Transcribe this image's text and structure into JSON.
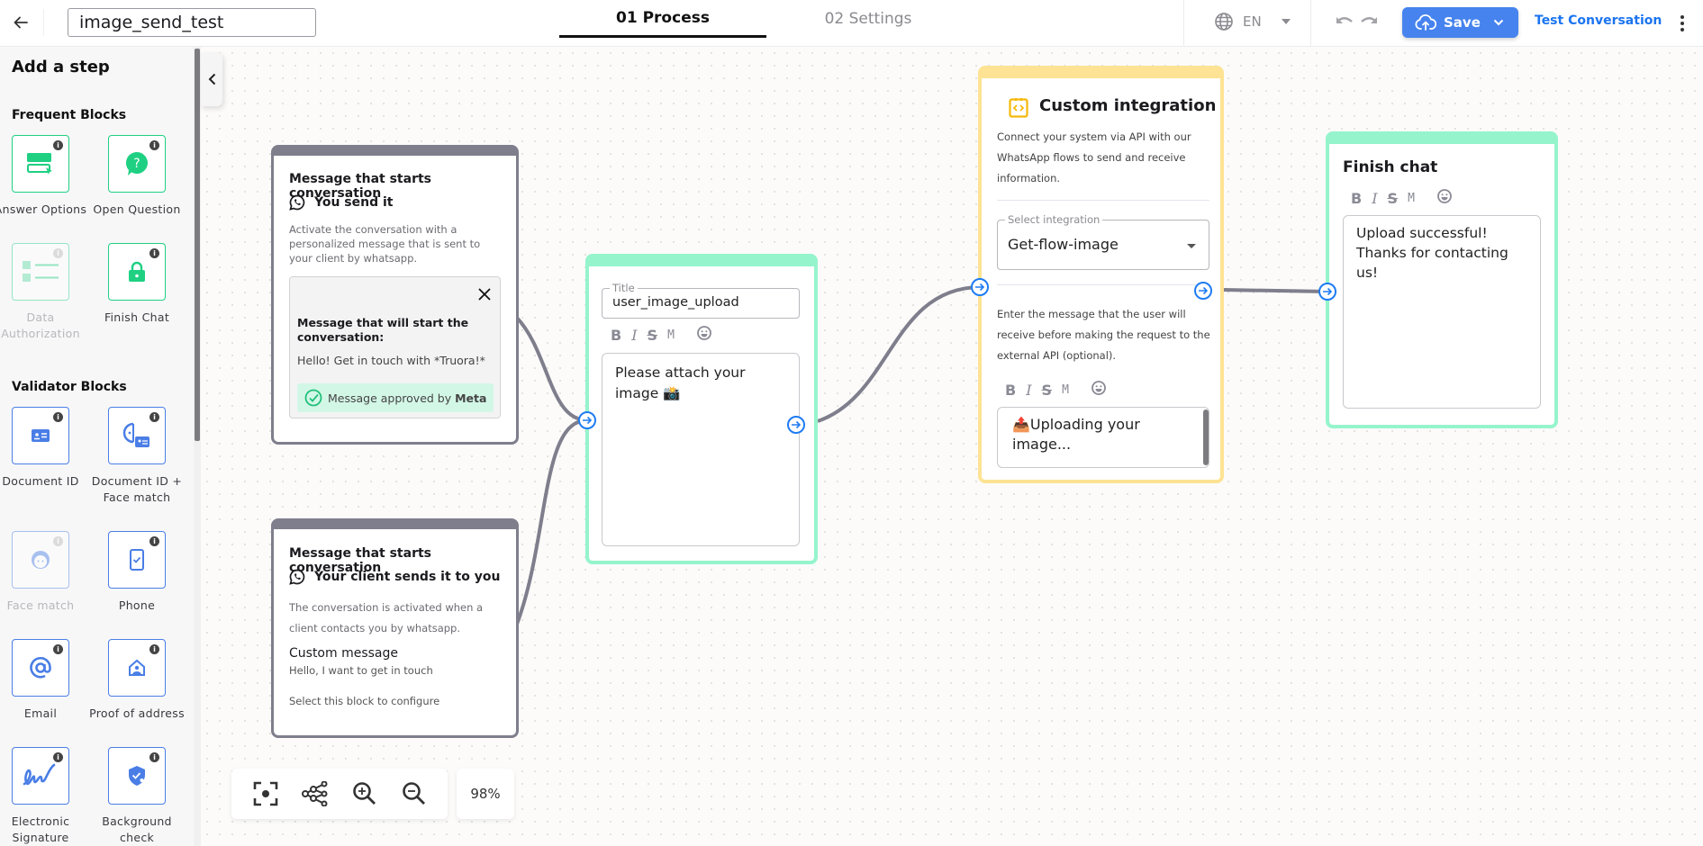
{
  "header": {
    "back_icon": "arrow-left-icon",
    "flow_name": "image_send_test",
    "tabs": [
      {
        "label": "01 Process",
        "active": true
      },
      {
        "label": "02 Settings",
        "active": false
      }
    ],
    "language": {
      "icon": "globe-icon",
      "value": "EN"
    },
    "undo_icon": "undo-icon",
    "redo_icon": "redo-icon",
    "save_label": "Save",
    "save_icon": "cloud-upload-icon",
    "test_conversation_label": "Test Conversation",
    "more_icon": "kebab-menu-icon",
    "colors": {
      "save_bg": "#4683ee",
      "link": "#1b74f0"
    }
  },
  "sidebar": {
    "title": "Add a step",
    "sections": [
      {
        "title": "Frequent Blocks",
        "items": [
          {
            "label": "Answer Options",
            "icon": "answer-options-icon",
            "disabled": false
          },
          {
            "label": "Open Question",
            "icon": "question-bubble-icon",
            "disabled": false
          },
          {
            "label": "Data Authorization",
            "icon": "checklist-icon",
            "disabled": true
          },
          {
            "label": "Finish Chat",
            "icon": "lock-icon",
            "disabled": false
          }
        ]
      },
      {
        "title": "Validator Blocks",
        "items": [
          {
            "label": "Document ID",
            "icon": "id-card-icon",
            "disabled": false
          },
          {
            "label": "Document ID + Face match",
            "icon": "face-id-card-icon",
            "disabled": false
          },
          {
            "label": "Face match",
            "icon": "face-icon",
            "disabled": true
          },
          {
            "label": "Phone",
            "icon": "phone-check-icon",
            "disabled": false
          },
          {
            "label": "Email",
            "icon": "at-sign-icon",
            "disabled": false
          },
          {
            "label": "Proof of address",
            "icon": "home-pin-icon",
            "disabled": false
          },
          {
            "label": "Electronic Signature",
            "icon": "signature-icon",
            "disabled": false
          },
          {
            "label": "Background check",
            "icon": "shield-check-icon",
            "disabled": false
          }
        ]
      }
    ],
    "collapse_icon": "chevron-left-icon"
  },
  "canvas": {
    "nodes": {
      "start_outbound": {
        "title": "Message that starts conversation",
        "subtitle": "You send it",
        "icon": "whatsapp-icon",
        "description": "Activate the conversation with a personalized message that is sent to your client by whatsapp.",
        "message_label": "Message that will start the conversation:",
        "message_text": "Hello! Get in touch with *Truora!*",
        "approved_prefix": "Message approved by ",
        "approved_brand": "Meta",
        "close_icon": "close-icon"
      },
      "start_inbound": {
        "title": "Message that starts conversation",
        "subtitle": "Your client sends it to you",
        "icon": "whatsapp-icon",
        "description": "The conversation is activated when a client contacts you by whatsapp.",
        "custom_label": "Custom message",
        "custom_text": "Hello, I want to get in touch",
        "hint": "Select this block to configure"
      },
      "image_upload": {
        "title_legend": "Title",
        "title_value": "user_image_upload",
        "message": "Please attach your image 📸"
      },
      "custom_integration": {
        "title": "Custom integration",
        "icon": "code-brackets-icon",
        "description": "Connect your system via API with our WhatsApp flows to send and receive information.",
        "select_legend": "Select integration",
        "select_value": "Get-flow-image",
        "pre_message_description": "Enter the message that the user will receive before making the request to the external API (optional).",
        "pre_message": "📤Uploading your image..."
      },
      "finish_chat": {
        "title": "Finish chat",
        "message": "Upload successful! Thanks for contacting us!"
      }
    },
    "format_toolbar": {
      "bold": "B",
      "italic": "I",
      "strike": "S",
      "mono": "M",
      "emoji_icon": "emoji-icon"
    },
    "colors": {
      "grey_node": "#7e7e8c",
      "green_node": "#95f4cc",
      "yellow_node": "#fde393",
      "port": "#1e7cf2",
      "edge": "#7e7e8c"
    }
  },
  "toolbar": {
    "fit_icon": "focus-frame-icon",
    "layout_icon": "tree-layout-icon",
    "zoom_in_icon": "zoom-in-icon",
    "zoom_out_icon": "zoom-out-icon",
    "zoom_level": "98%"
  }
}
